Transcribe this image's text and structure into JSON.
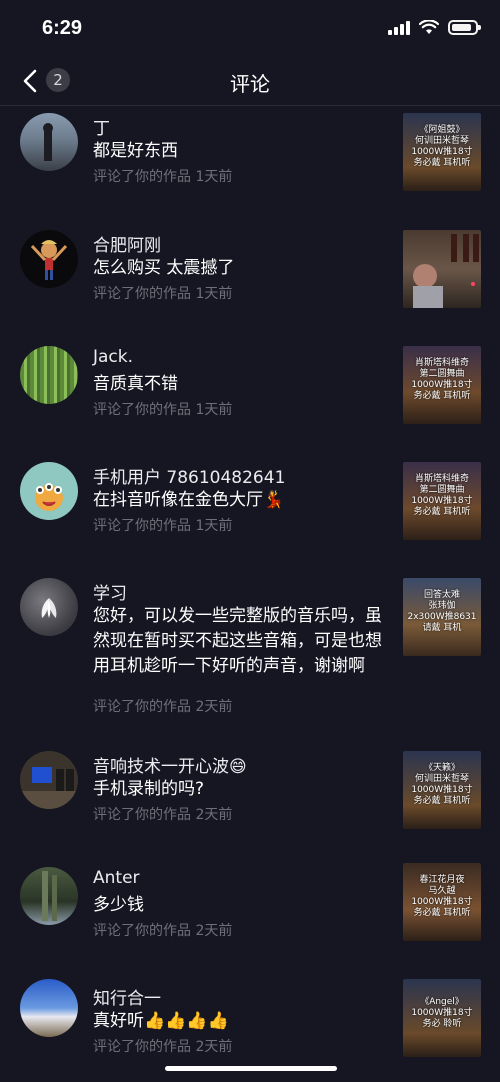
{
  "status": {
    "time": "6:29"
  },
  "nav": {
    "badge": "2",
    "title": "评论"
  },
  "comments": [
    {
      "name": "丁",
      "text": "都是好东西",
      "meta": "评论了你的作品  1天前",
      "thumb_text": "《阿姐鼓》\n何训田米哲琴\n1000W推18寸\n务必戴  耳机听"
    },
    {
      "name": "合肥阿刚",
      "text": "怎么购买 太震撼了",
      "meta": "评论了你的作品  1天前",
      "thumb_text": ""
    },
    {
      "name": "Jack.",
      "text": "音质真不错",
      "meta": "评论了你的作品  1天前",
      "thumb_text": "肖斯塔科维奇\n第二圆舞曲\n1000W推18寸\n务必戴  耳机听"
    },
    {
      "name": "手机用户 78610482641",
      "text": "在抖音听像在金色大厅💃",
      "meta": "评论了你的作品  1天前",
      "thumb_text": "肖斯塔科维奇\n第二圆舞曲\n1000W推18寸\n务必戴  耳机听"
    },
    {
      "name": "学习",
      "text": "您好，可以发一些完整版的音乐吗，虽然现在暂时买不起这些音箱，可是也想用耳机趁听一下好听的声音，谢谢啊",
      "meta": "评论了你的作品  2天前",
      "thumb_text": "回答太难\n张玮伽\n2x300W推8631\n请戴  耳机"
    },
    {
      "name": "音响技术一开心波😄",
      "text": "手机录制的吗?",
      "meta": "评论了你的作品  2天前",
      "thumb_text": "《天籁》\n何训田米哲琴\n1000W推18寸\n务必戴  耳机听"
    },
    {
      "name": "Anter",
      "text": "多少钱",
      "meta": "评论了你的作品  2天前",
      "thumb_text": "春江花月夜\n马久越\n1000W推18寸\n务必戴  耳机听"
    },
    {
      "name": "知行合一",
      "text": "真好听👍👍👍👍",
      "meta": "评论了你的作品  2天前",
      "thumb_text": "《Angel》\n1000W推18寸\n务必  聆听"
    }
  ],
  "colors": {
    "background": "#161622",
    "meta_text": "#6f6f7a",
    "badge_bg": "#3d3d47"
  }
}
